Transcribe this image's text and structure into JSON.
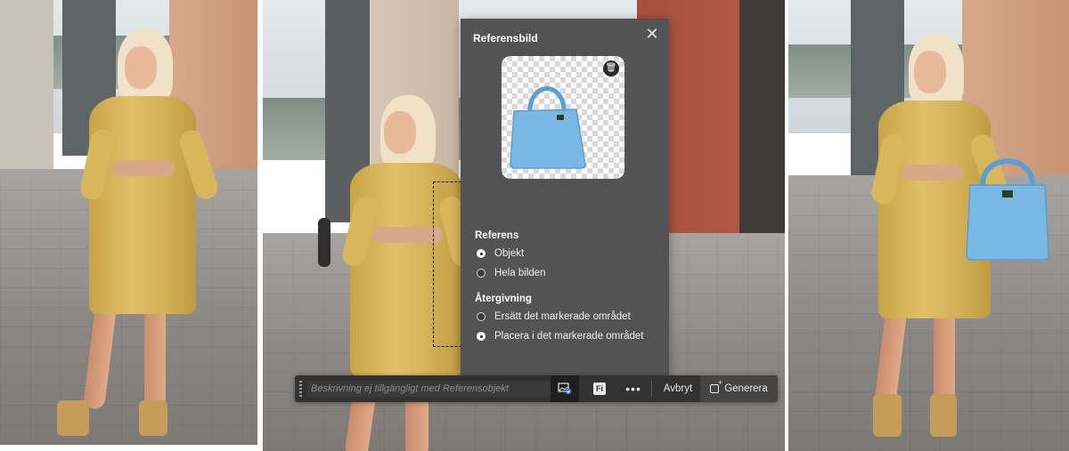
{
  "dialog": {
    "title": "Referensbild",
    "close_icon": "close-icon",
    "reference_image": {
      "subject": "light blue handbag",
      "delete_icon": "trash-icon"
    },
    "reference_section": {
      "title": "Referens",
      "options": [
        {
          "label": "Objekt",
          "selected": true
        },
        {
          "label": "Hela bilden",
          "selected": false
        }
      ]
    },
    "rendering_section": {
      "title": "Återgivning",
      "options": [
        {
          "label": "Ersätt det markerade området",
          "selected": false
        },
        {
          "label": "Placera i det markerade området",
          "selected": true
        }
      ]
    }
  },
  "toolbar": {
    "prompt_placeholder": "Beskrivning ej tillgängligt med Referensobjekt",
    "reference_image_icon": "reference-image-icon",
    "fi_label": "Fi",
    "more_label": "•••",
    "cancel_label": "Avbryt",
    "generate_label": "Generera"
  },
  "colors": {
    "dialog_bg": "#535353",
    "toolbar_bg": "#323232",
    "bag_blue": "#7ab8e6",
    "dress_yellow": "#d8b65c"
  }
}
